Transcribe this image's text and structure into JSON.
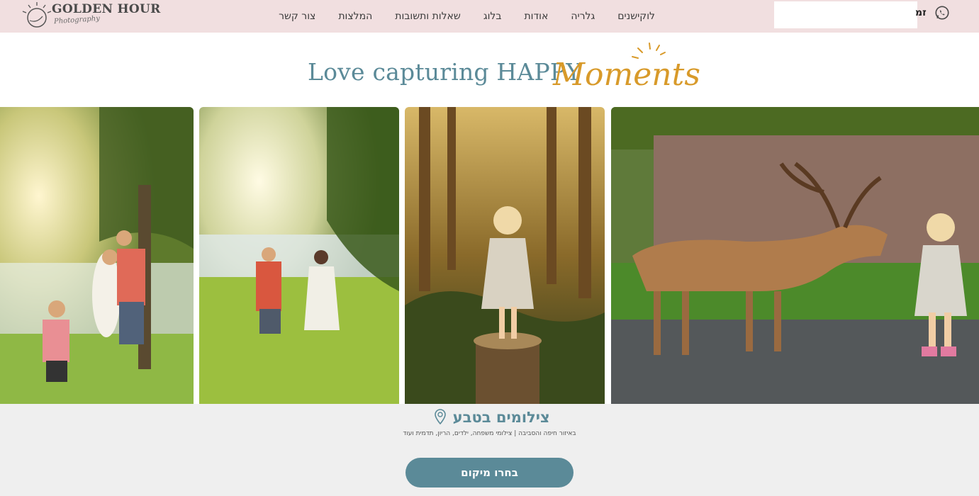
{
  "header": {
    "logo_text": "GOLDEN HOUR",
    "logo_sub": "Photography",
    "nav": [
      "לוקישנים",
      "גלריה",
      "אודות",
      "בלוג",
      "שאלות ותשובות",
      "המלצות",
      "צור קשר"
    ],
    "phone_label": "זמ",
    "search_value": ""
  },
  "hero": {
    "title": "Love capturing HAPPY",
    "script": "Moments"
  },
  "section": {
    "title": "צילומים בטבע",
    "subtitle": "באיזור חיפה והסביבה | צילומי משפחה, ילדים, הריון, תדמית ועוד",
    "cta_label": "בחרו מיקום"
  },
  "icons": {
    "whatsapp": "whatsapp-icon",
    "pin": "location-pin-icon",
    "sun": "sun-icon"
  },
  "colors": {
    "header_bg": "#f1dfe0",
    "accent_teal": "#5b8a98",
    "accent_gold": "#d89a2a",
    "band_bg": "#efefef"
  }
}
